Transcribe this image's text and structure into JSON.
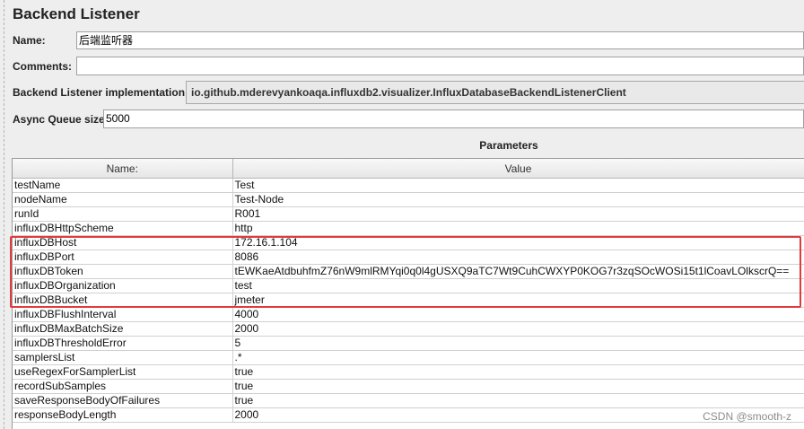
{
  "panel": {
    "title": "Backend Listener"
  },
  "form": {
    "name_label": "Name:",
    "name_value": "后端监听器",
    "comments_label": "Comments:",
    "comments_value": "",
    "impl_label": "Backend Listener implementation",
    "impl_value": "io.github.mderevyankoaqa.influxdb2.visualizer.InfluxDatabaseBackendListenerClient",
    "queue_label": "Async Queue size",
    "queue_value": "5000"
  },
  "parameters": {
    "title": "Parameters",
    "col_name": "Name:",
    "col_value": "Value",
    "rows": [
      {
        "name": "testName",
        "value": "Test"
      },
      {
        "name": "nodeName",
        "value": "Test-Node"
      },
      {
        "name": "runId",
        "value": "R001"
      },
      {
        "name": "influxDBHttpScheme",
        "value": "http"
      },
      {
        "name": "influxDBHost",
        "value": "172.16.1.104"
      },
      {
        "name": "influxDBPort",
        "value": "8086"
      },
      {
        "name": "influxDBToken",
        "value": "tEWKaeAtdbuhfmZ76nW9mlRMYqi0q0l4gUSXQ9aTC7Wt9CuhCWXYP0KOG7r3zqSOcWOSi15t1lCoavLOlkscrQ=="
      },
      {
        "name": "influxDBOrganization",
        "value": "test"
      },
      {
        "name": "influxDBBucket",
        "value": "jmeter"
      },
      {
        "name": "influxDBFlushInterval",
        "value": "4000"
      },
      {
        "name": "influxDBMaxBatchSize",
        "value": "2000"
      },
      {
        "name": "influxDBThresholdError",
        "value": "5"
      },
      {
        "name": "samplersList",
        "value": ".*"
      },
      {
        "name": "useRegexForSamplerList",
        "value": "true"
      },
      {
        "name": "recordSubSamples",
        "value": "true"
      },
      {
        "name": "saveResponseBodyOfFailures",
        "value": "true"
      },
      {
        "name": "responseBodyLength",
        "value": "2000"
      }
    ]
  },
  "watermark": "CSDN @smooth-z",
  "colors": {
    "highlight_border": "#e03c3c",
    "panel_background": "#eeeeee"
  }
}
